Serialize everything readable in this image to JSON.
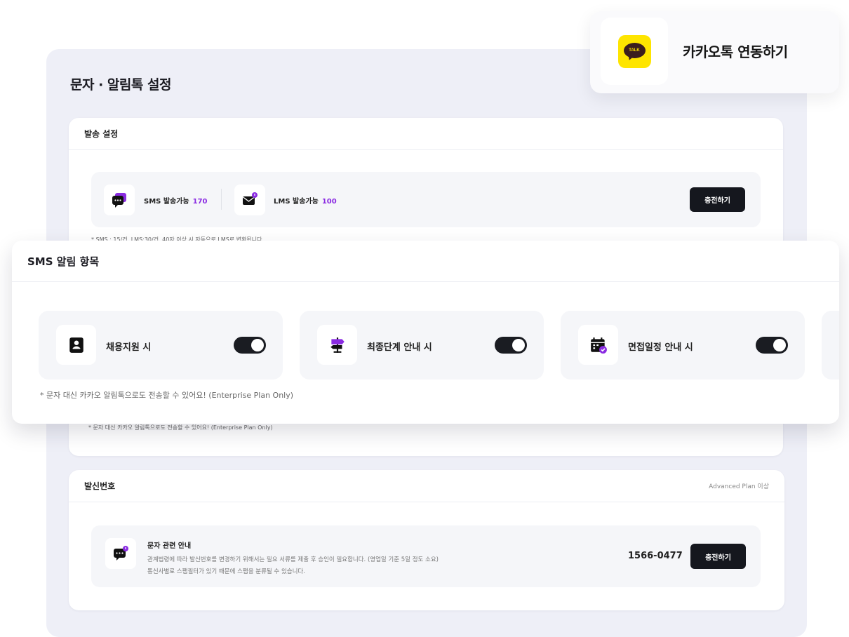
{
  "panel": {
    "title": "문자 · 알림톡 설정"
  },
  "send_settings": {
    "title": "발송 설정",
    "sms_label": "SMS 발송가능",
    "sms_count": "170",
    "lms_label": "LMS 발송가능",
    "lms_count": "100",
    "charge_button": "충전하기",
    "note": "* SMS : 15/건, LMS:30/건, 40자 이상 시 자동으로 LMS로 변환됩니다",
    "bottom_note": "* 문자 대신 카카오 알림톡으로도 전송할 수 있어요! (Enterprise Plan Only)"
  },
  "sender": {
    "title": "발신번호",
    "plan_badge": "Advanced Plan 이상",
    "info_title": "문자 관련 안내",
    "info_line1": "관계법령에 따라 발신번호를 변경하기 위해서는 필요 서류를 제출 후 승인이 필요합니다. (영업일 기준 5일 정도 소요)",
    "info_line2": "통신사별로 스팸필터가 있기 때문에 스팸을 분류될 수 있습니다.",
    "phone": "1566-0477",
    "charge_button": "충전하기"
  },
  "kakao": {
    "label": "카카오톡 연동하기",
    "logo_text": "TALK"
  },
  "sms_alerts": {
    "title": "SMS 알림 항목",
    "items": [
      {
        "label": "채용지원 시",
        "icon": "id-card-icon",
        "enabled": true
      },
      {
        "label": "최종단계 안내 시",
        "icon": "signpost-icon",
        "enabled": true
      },
      {
        "label": "면접일정 안내 시",
        "icon": "calendar-check-icon",
        "enabled": true
      }
    ],
    "note": "* 문자 대신 카카오 알림톡으로도 전송할 수 있어요! (Enterprise Plan Only)"
  },
  "colors": {
    "accent": "#8a2be2",
    "dark": "#15171e",
    "kakao_yellow": "#fee500"
  }
}
